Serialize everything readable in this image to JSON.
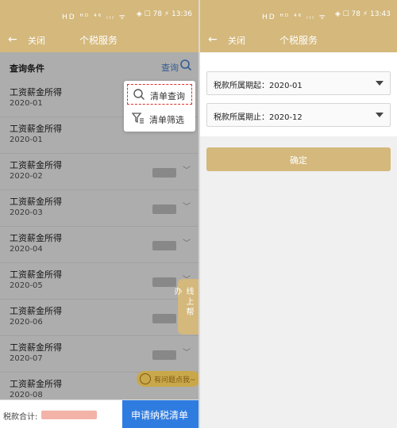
{
  "left": {
    "status": {
      "left_icons": "HD ᴴᴰ ⁴⁶ ᵢₗₗ ᯤ",
      "right_icons": "◈ ☐ 78 ⚡ 13:36"
    },
    "appbar": {
      "back": "←",
      "close": "关闭",
      "title": "个税服务"
    },
    "conditions": {
      "label": "查询条件",
      "query": "查询"
    },
    "items": [
      {
        "name": "工资薪金所得",
        "period": "2020-01"
      },
      {
        "name": "工资薪金所得",
        "period": "2020-01"
      },
      {
        "name": "工资薪金所得",
        "period": "2020-02"
      },
      {
        "name": "工资薪金所得",
        "period": "2020-03"
      },
      {
        "name": "工资薪金所得",
        "period": "2020-04"
      },
      {
        "name": "工资薪金所得",
        "period": "2020-05"
      },
      {
        "name": "工资薪金所得",
        "period": "2020-06"
      },
      {
        "name": "工资薪金所得",
        "period": "2020-07"
      },
      {
        "name": "工资薪金所得",
        "period": "2020-08"
      }
    ],
    "popup": {
      "item1": "清单查询",
      "item2": "清单筛选"
    },
    "float_tab": "线上帮办",
    "pill": "有问题点我~",
    "footer": {
      "total_label": "税款合计:",
      "apply_button": "申请纳税清单"
    }
  },
  "right": {
    "status": {
      "left_icons": "HD ᴴᴰ ⁴⁶ ᵢₗₗ ᯤ",
      "right_icons": "◈ ☐ 78 ⚡ 13:43"
    },
    "appbar": {
      "back": "←",
      "close": "关闭",
      "title": "个税服务"
    },
    "select_start": "税款所属期起：2020-01",
    "select_end": "税款所属期止：2020-12",
    "confirm": "确定"
  },
  "colors": {
    "brand": "#d4b87c",
    "blue": "#2f7ce0",
    "link": "#4d8ad9"
  }
}
